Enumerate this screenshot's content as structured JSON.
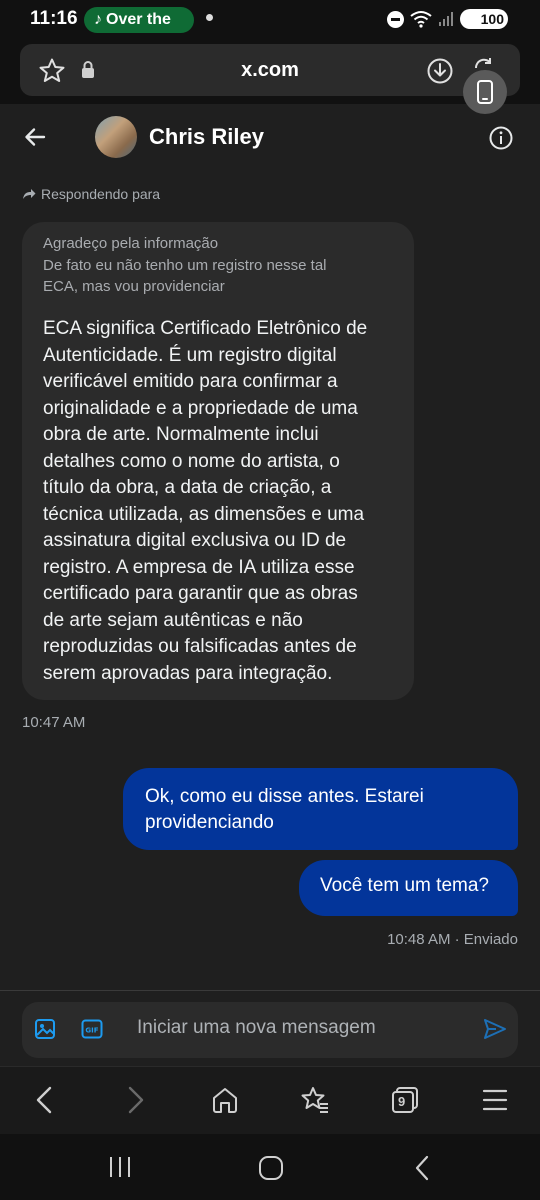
{
  "status_bar": {
    "time": "11:16",
    "media_pill": "Over the",
    "battery": "100"
  },
  "browser": {
    "url": "x.com",
    "tab_count": "9"
  },
  "chat": {
    "contact_name": "Chris Riley",
    "replying_label": "Respondendo para",
    "quote_lines": [
      "Agradeço pela informação",
      "De fato eu não tenho um registro nesse tal",
      "ECA, mas vou providenciar"
    ],
    "incoming_lines": [
      "ECA significa Certificado Eletrônico de",
      "Autenticidade. É um registro digital",
      "verificável emitido para confirmar a",
      "originalidade e a propriedade de uma",
      "obra de arte. Normalmente inclui",
      "detalhes como o nome do artista, o",
      "título da obra, a data de criação, a",
      "técnica utilizada, as dimensões e uma",
      "assinatura digital exclusiva ou ID de",
      "registro. A empresa de IA utiliza esse",
      "certificado para garantir que as obras",
      "de arte sejam autênticas e não",
      "reproduzidas ou falsificadas antes de",
      "serem aprovadas para integração."
    ],
    "incoming_time": "10:47 AM",
    "outgoing_1_lines": [
      "Ok, como eu disse antes. Estarei",
      "providenciando"
    ],
    "outgoing_2": "Você tem um tema?",
    "outgoing_time": "10:48 AM · Enviado"
  },
  "composer": {
    "placeholder": "Iniciar uma nova mensagem"
  },
  "colors": {
    "outgoing_bubble": "#03359a",
    "incoming_bubble": "#2b2b2b",
    "accent": "#1d9bf0",
    "media_pill": "#0f6b35"
  }
}
